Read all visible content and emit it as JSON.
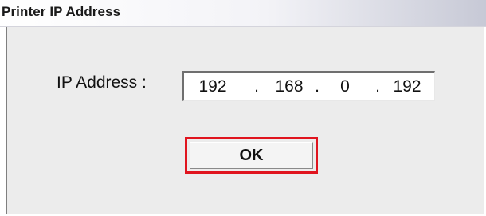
{
  "window": {
    "title": "Printer IP Address"
  },
  "form": {
    "ip_label": "IP Address :",
    "ip_octets": [
      "192",
      "168",
      "0",
      "192"
    ],
    "separator": "."
  },
  "actions": {
    "ok_label": "OK",
    "highlight_color": "#e0141e"
  }
}
